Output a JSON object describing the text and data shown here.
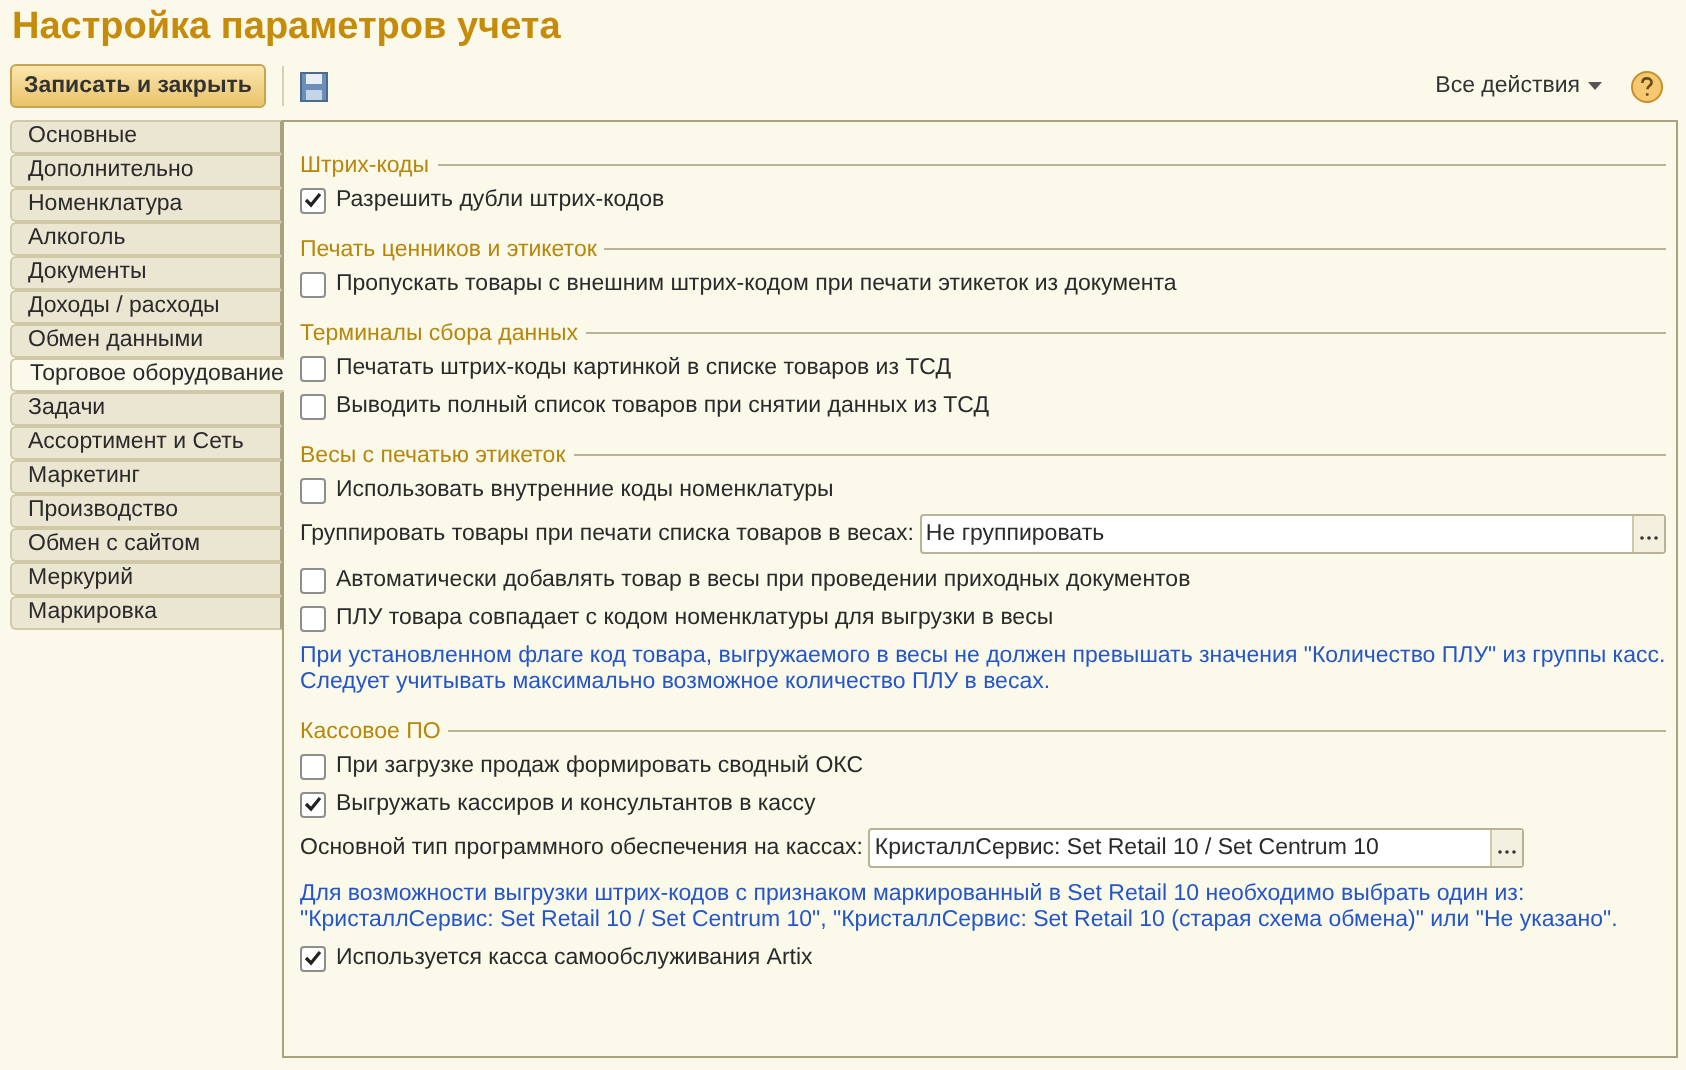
{
  "title": "Настройка параметров учета",
  "toolbar": {
    "save_close": "Записать и закрыть",
    "all_actions": "Все действия"
  },
  "tabs": [
    {
      "label": "Основные",
      "selected": false
    },
    {
      "label": "Дополнительно",
      "selected": false
    },
    {
      "label": "Номенклатура",
      "selected": false
    },
    {
      "label": "Алкоголь",
      "selected": false
    },
    {
      "label": "Документы",
      "selected": false
    },
    {
      "label": "Доходы / расходы",
      "selected": false
    },
    {
      "label": "Обмен данными",
      "selected": false
    },
    {
      "label": "Торговое оборудование",
      "selected": true
    },
    {
      "label": "Задачи",
      "selected": false
    },
    {
      "label": "Ассортимент и Сеть",
      "selected": false
    },
    {
      "label": "Маркетинг",
      "selected": false
    },
    {
      "label": "Производство",
      "selected": false
    },
    {
      "label": "Обмен с сайтом",
      "selected": false
    },
    {
      "label": "Меркурий",
      "selected": false
    },
    {
      "label": "Маркировка",
      "selected": false
    }
  ],
  "sections": [
    {
      "title": "Штрих-коды",
      "items": [
        {
          "kind": "checkbox",
          "label": "Разрешить дубли штрих-кодов",
          "checked": true
        }
      ]
    },
    {
      "title": "Печать ценников и этикеток",
      "items": [
        {
          "kind": "checkbox",
          "label": "Пропускать товары с внешним штрих-кодом при печати этикеток из документа",
          "checked": false
        }
      ]
    },
    {
      "title": "Терминалы сбора данных",
      "items": [
        {
          "kind": "checkbox",
          "label": "Печатать штрих-коды картинкой в списке товаров из ТСД",
          "checked": false
        },
        {
          "kind": "checkbox",
          "label": "Выводить полный список товаров при снятии данных из ТСД",
          "checked": false
        }
      ]
    },
    {
      "title": "Весы с печатью этикеток",
      "items": [
        {
          "kind": "checkbox",
          "label": "Использовать внутренние коды номенклатуры",
          "checked": false
        },
        {
          "kind": "select",
          "label": "Группировать товары при печати списка товаров в весах:",
          "value": "Не группировать",
          "full": true
        },
        {
          "kind": "checkbox",
          "label": "Автоматически добавлять товар в весы при проведении приходных документов",
          "checked": false
        },
        {
          "kind": "checkbox",
          "label": "ПЛУ товара совпадает с кодом номенклатуры для выгрузки в весы",
          "checked": false
        },
        {
          "kind": "note",
          "lines": [
            "При установленном флаге код товара, выгружаемого в весы не должен превышать значения \"Количество ПЛУ\" из группы касс.",
            "Следует учитывать максимально возможное количество ПЛУ в весах."
          ]
        }
      ]
    },
    {
      "title": "Кассовое ПО",
      "items": [
        {
          "kind": "checkbox",
          "label": "При загрузке продаж формировать сводный ОКС",
          "checked": false
        },
        {
          "kind": "checkbox",
          "label": "Выгружать кассиров и консультантов в кассу",
          "checked": true
        },
        {
          "kind": "select",
          "label": "Основной тип программного обеспечения на кассах:",
          "value": "КристаллСервис: Set Retail 10 / Set Centrum 10",
          "full": false
        },
        {
          "kind": "note",
          "lines": [
            "Для возможности выгрузки штрих-кодов с признаком маркированный в Set Retail 10 необходимо выбрать один из:",
            "\"КристаллСервис: Set Retail 10 / Set Centrum 10\", \"КристаллСервис: Set Retail 10 (старая схема обмена)\" или \"Не указано\"."
          ]
        },
        {
          "kind": "checkbox",
          "label": "Используется касса самообслуживания Artix",
          "checked": true
        }
      ]
    }
  ]
}
